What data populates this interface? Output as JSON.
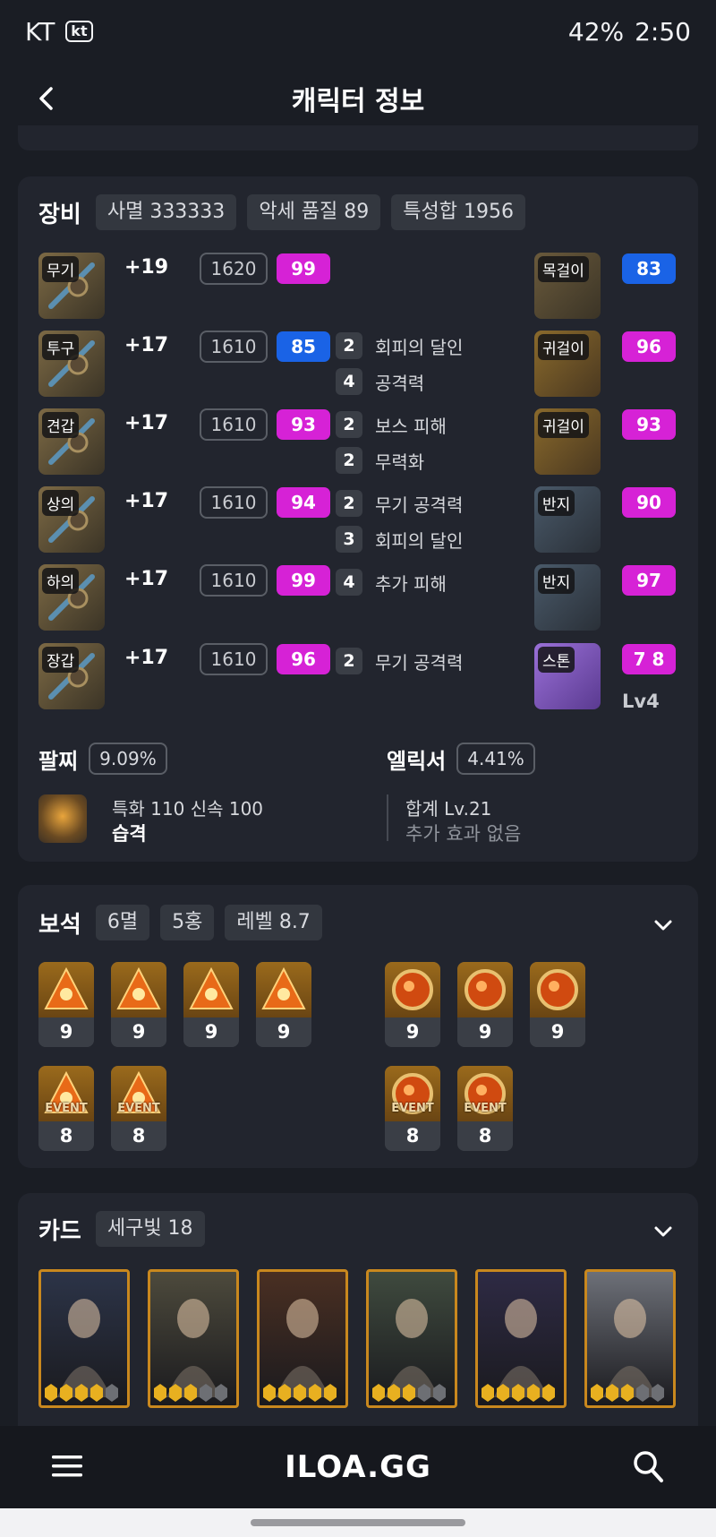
{
  "status": {
    "carrier": "KT",
    "carrier_badge": "kt",
    "battery": "42%",
    "time": "2:50"
  },
  "header": {
    "title": "캐릭터 정보"
  },
  "equipment": {
    "title": "장비",
    "chips": [
      "사멸 333333",
      "악세 품질 89",
      "특성합 1956"
    ],
    "items": [
      {
        "slot": "무기",
        "plus": "+19",
        "level": "1620",
        "quality": "99",
        "quality_color": "#d622d6"
      },
      {
        "slot": "투구",
        "plus": "+17",
        "level": "1610",
        "quality": "85",
        "quality_color": "#1a63e6"
      },
      {
        "slot": "견갑",
        "plus": "+17",
        "level": "1610",
        "quality": "93",
        "quality_color": "#d622d6"
      },
      {
        "slot": "상의",
        "plus": "+17",
        "level": "1610",
        "quality": "94",
        "quality_color": "#d622d6"
      },
      {
        "slot": "하의",
        "plus": "+17",
        "level": "1610",
        "quality": "99",
        "quality_color": "#d622d6"
      },
      {
        "slot": "장갑",
        "plus": "+17",
        "level": "1610",
        "quality": "96",
        "quality_color": "#d622d6"
      }
    ],
    "engravings": [
      {
        "num": "2",
        "name": "회피의 달인"
      },
      {
        "num": "4",
        "name": "공격력"
      },
      {
        "num": "2",
        "name": "보스 피해"
      },
      {
        "num": "2",
        "name": "무력화"
      },
      {
        "num": "2",
        "name": "무기 공격력"
      },
      {
        "num": "3",
        "name": "회피의 달인"
      },
      {
        "num": "4",
        "name": "추가 피해"
      },
      {
        "num": "2",
        "name": "무기 공격력"
      }
    ],
    "accessories": [
      {
        "slot": "목걸이",
        "quality": "83",
        "quality_color": "#1a63e6"
      },
      {
        "slot": "귀걸이",
        "quality": "96",
        "quality_color": "#d622d6"
      },
      {
        "slot": "귀걸이",
        "quality": "93",
        "quality_color": "#d622d6"
      },
      {
        "slot": "반지",
        "quality": "90",
        "quality_color": "#d622d6"
      },
      {
        "slot": "반지",
        "quality": "97",
        "quality_color": "#d622d6"
      },
      {
        "slot": "스톤",
        "quality": "7 8",
        "quality_color": "#d622d6"
      }
    ],
    "stone_level": "Lv4",
    "bracelet": {
      "title": "팔찌",
      "percent": "9.09%",
      "stats": "특화 110  신속 100",
      "effect": "습격"
    },
    "elixir": {
      "title": "엘릭서",
      "percent": "4.41%",
      "sum": "합계 Lv.21",
      "effect": "추가 효과 없음"
    }
  },
  "gems": {
    "title": "보석",
    "chips": [
      "6멸",
      "5홍",
      "레벨 8.7"
    ],
    "left": [
      {
        "level": "9",
        "event": ""
      },
      {
        "level": "9",
        "event": ""
      },
      {
        "level": "9",
        "event": ""
      },
      {
        "level": "9",
        "event": ""
      },
      {
        "level": "8",
        "event": "EVENT"
      },
      {
        "level": "8",
        "event": "EVENT"
      }
    ],
    "right": [
      {
        "level": "9",
        "event": ""
      },
      {
        "level": "9",
        "event": ""
      },
      {
        "level": "9",
        "event": ""
      },
      {
        "level": "8",
        "event": "EVENT"
      },
      {
        "level": "8",
        "event": "EVENT"
      }
    ]
  },
  "cards": {
    "title": "카드",
    "chips": [
      "세구빛 18"
    ],
    "items": [
      {
        "awaken": 4,
        "bg": "#2c3448"
      },
      {
        "awaken": 3,
        "bg": "#4d4a3c"
      },
      {
        "awaken": 5,
        "bg": "#4a2f22"
      },
      {
        "awaken": 3,
        "bg": "#3f4a3e"
      },
      {
        "awaken": 5,
        "bg": "#2e2a44"
      },
      {
        "awaken": 3,
        "bg": "#6d7078"
      }
    ]
  },
  "bottom_nav": {
    "brand": "ILOA.GG"
  }
}
